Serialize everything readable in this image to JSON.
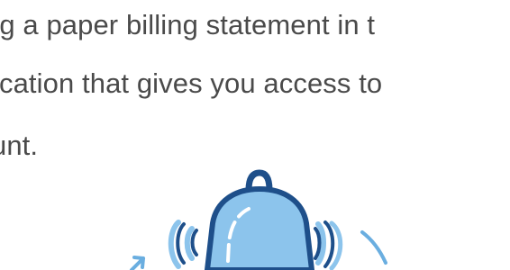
{
  "content": {
    "paragraph_lines": [
      "ng a paper billing statement in t",
      "ication that gives you access to",
      "unt."
    ]
  },
  "illustration": {
    "icon": "bell-ringing-icon",
    "colors": {
      "fill_light": "#8cc4ec",
      "stroke_dark": "#1e4f8a",
      "accent": "#ffffff"
    }
  }
}
